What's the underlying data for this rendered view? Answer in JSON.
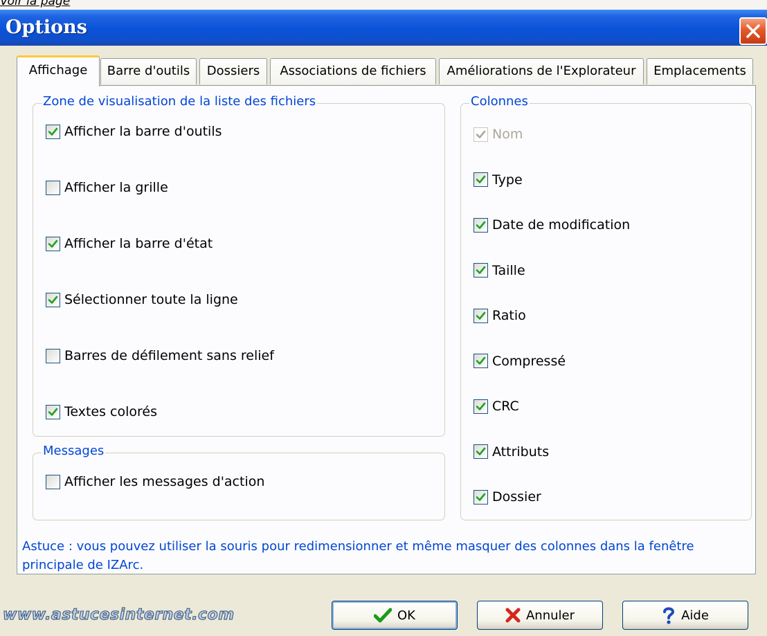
{
  "page": {
    "top_link": "Voir la page",
    "title": "Options"
  },
  "tabs": [
    {
      "label": "Affichage",
      "active": true
    },
    {
      "label": "Barre d'outils",
      "active": false
    },
    {
      "label": "Dossiers",
      "active": false
    },
    {
      "label": "Associations de fichiers",
      "active": false
    },
    {
      "label": "Améliorations de l'Explorateur",
      "active": false
    },
    {
      "label": "Emplacements",
      "active": false
    }
  ],
  "file_list_group": {
    "label": "Zone de visualisation de la liste des fichiers",
    "items": [
      {
        "label": "Afficher la barre d'outils",
        "checked": true
      },
      {
        "label": "Afficher la grille",
        "checked": false
      },
      {
        "label": "Afficher la barre d'état",
        "checked": true
      },
      {
        "label": "Sélectionner toute la ligne",
        "checked": true
      },
      {
        "label": "Barres de défilement sans relief",
        "checked": false
      },
      {
        "label": "Textes colorés",
        "checked": true
      }
    ]
  },
  "messages_group": {
    "label": "Messages",
    "items": [
      {
        "label": "Afficher les messages d'action",
        "checked": false
      }
    ]
  },
  "columns_group": {
    "label": "Colonnes",
    "items": [
      {
        "label": "Nom",
        "checked": true,
        "disabled": true
      },
      {
        "label": "Type",
        "checked": true,
        "disabled": false
      },
      {
        "label": "Date de modification",
        "checked": true,
        "disabled": false
      },
      {
        "label": "Taille",
        "checked": true,
        "disabled": false
      },
      {
        "label": "Ratio",
        "checked": true,
        "disabled": false
      },
      {
        "label": "Compressé",
        "checked": true,
        "disabled": false
      },
      {
        "label": "CRC",
        "checked": true,
        "disabled": false
      },
      {
        "label": "Attributs",
        "checked": true,
        "disabled": false
      },
      {
        "label": "Dossier",
        "checked": true,
        "disabled": false
      }
    ]
  },
  "hint": "Astuce : vous pouvez utiliser la souris pour redimensionner et même masquer des colonnes dans la fenêtre principale de IZArc.",
  "buttons": {
    "ok": "OK",
    "cancel": "Annuler",
    "help": "Aide"
  },
  "watermark": "www.astucesinternet.com",
  "colors": {
    "accent": "#0046d5",
    "titlebar": "#0a52d8",
    "check": "#21a121",
    "tab_highlight": "#ffc83c"
  },
  "icons": {
    "close": "close-icon",
    "check": "checkmark-icon",
    "ok": "green-check-icon",
    "cancel": "red-x-icon",
    "help": "blue-question-icon"
  }
}
